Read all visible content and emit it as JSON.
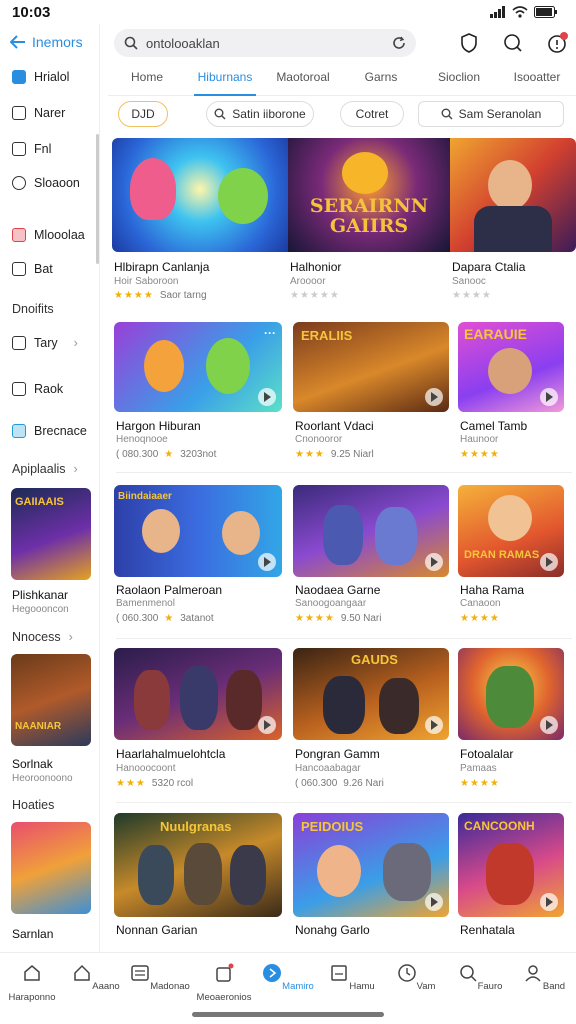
{
  "status": {
    "time": "10:03"
  },
  "search": {
    "placeholder": "ontolooaklan"
  },
  "tabs": [
    {
      "label": "Home"
    },
    {
      "label": "Hiburnans"
    },
    {
      "label": "Maotoroal"
    },
    {
      "label": "Garns"
    },
    {
      "label": "Sioclion"
    },
    {
      "label": "Isooatter"
    }
  ],
  "chips": [
    {
      "label": "DJD"
    },
    {
      "label": "Satin iiborone"
    },
    {
      "label": "Cotret"
    },
    {
      "label": "Sam Seranolan"
    }
  ],
  "sidebar": {
    "back_label": "Inemors",
    "items": [
      {
        "label": "Hrialol"
      },
      {
        "label": "Narer"
      },
      {
        "label": "Fnl"
      },
      {
        "label": "Sloaoon"
      },
      {
        "label": "Mlooolaa"
      },
      {
        "label": "Bat"
      }
    ],
    "section1": "Dnoifits",
    "items2": [
      {
        "label": "Tary"
      },
      {
        "label": "Raok"
      },
      {
        "label": "Brecnace"
      }
    ],
    "section2": "Apiplaalis",
    "thumb1": {
      "title": "Plishkanar",
      "sub": "Hegoooncon"
    },
    "section3": "Nnocess",
    "thumb2": {
      "title": "Sorlnak",
      "sub": "Heoroonoono"
    },
    "section4": "Hoaties",
    "thumb3": {
      "title": "Sarnlan"
    }
  },
  "rows": [
    [
      {
        "title": "Hlbirapn Canlanja",
        "sub": "Hoir Saboroon",
        "meta": "Saor tarng",
        "label": ""
      },
      {
        "title": "Halhonior",
        "sub": "Aroooor",
        "meta": "",
        "label": "SERAIRNN GAIIRS"
      },
      {
        "title": "Dapara Ctalia",
        "sub": "Sanooc",
        "meta": "",
        "label": ""
      }
    ],
    [
      {
        "title": "Hargon Hiburan",
        "sub": "Henoqnooe",
        "meta": "( 080.300",
        "meta2": "3203not",
        "label": ""
      },
      {
        "title": "Roorlant Vdaci",
        "sub": "Cnonooror",
        "meta": "9.25 Niarl",
        "label": "ERALIIS"
      },
      {
        "title": "Camel Tamb",
        "sub": "Haunoor",
        "meta": "",
        "label": "EARAUIE"
      }
    ],
    [
      {
        "title": "Raolaon Palmeroan",
        "sub": "Bamenmenol",
        "meta": "( 060.300",
        "meta2": "3atanot",
        "label": "Biindaiaaer"
      },
      {
        "title": "Naodaea Garne",
        "sub": "Sanoogoangaar",
        "meta": "9.50 Nari",
        "label": ""
      },
      {
        "title": "Haha Rama",
        "sub": "Canaoon",
        "meta": "",
        "label": "DRAN RAMAS"
      }
    ],
    [
      {
        "title": "Haarlahalmuelohtcla",
        "sub": "Hanooocoont",
        "meta": "5320 rcol",
        "label": ""
      },
      {
        "title": "Pongran Gamm",
        "sub": "Hancoaabagar",
        "meta": "( 060.300",
        "meta2": "9.26 Nari",
        "label": "GAUDS"
      },
      {
        "title": "Fotoalalar",
        "sub": "Pamaas",
        "meta": "",
        "label": ""
      }
    ],
    [
      {
        "title": "Nonnan Garian",
        "sub": "",
        "meta": "",
        "label": "Nuulgranas"
      },
      {
        "title": "Nonahg Garlo",
        "sub": "",
        "meta": "",
        "label": "PEIDOIUS"
      },
      {
        "title": "Renhatala",
        "sub": "",
        "meta": "",
        "label": "CANCOONH"
      }
    ]
  ],
  "bottom_nav": [
    {
      "label": "Haraponno"
    },
    {
      "label": "Aaano"
    },
    {
      "label": "Madonao"
    },
    {
      "label": "Meoaeronios"
    },
    {
      "label": "Mamiro"
    },
    {
      "label": "Hamu"
    },
    {
      "label": "Vam"
    },
    {
      "label": "Fauro"
    },
    {
      "label": "Band"
    }
  ],
  "colors": {
    "accent": "#2a8ee0",
    "star": "#f2b10a"
  }
}
